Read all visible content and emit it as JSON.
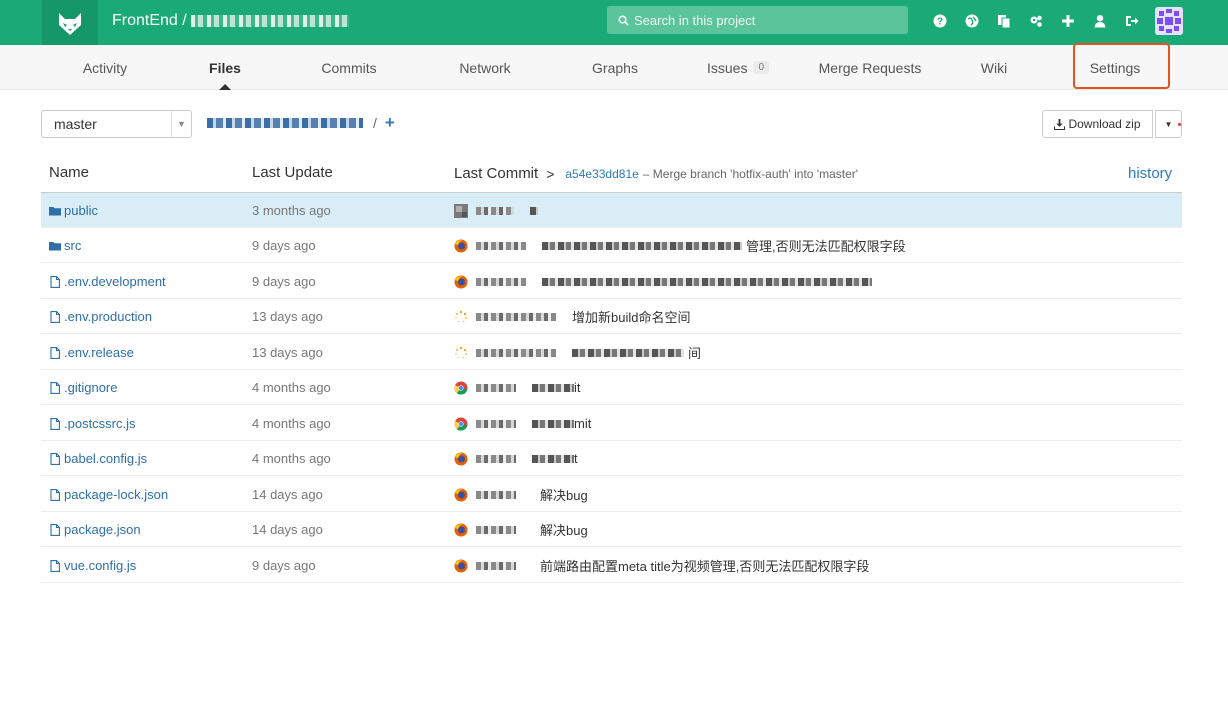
{
  "header": {
    "project_group": "FrontEnd /",
    "search_placeholder": "Search in this project",
    "icons": [
      "help-icon",
      "globe-icon",
      "copy-icon",
      "cogs-icon",
      "plus-icon",
      "user-icon",
      "sign-out-icon"
    ]
  },
  "nav": {
    "tabs": [
      {
        "label": "Activity"
      },
      {
        "label": "Files"
      },
      {
        "label": "Commits"
      },
      {
        "label": "Network"
      },
      {
        "label": "Graphs"
      },
      {
        "label": "Issues",
        "badge": "0"
      },
      {
        "label": "Merge Requests"
      },
      {
        "label": "Wiki"
      },
      {
        "label": "Settings"
      }
    ],
    "active_tab": "Files"
  },
  "toolbar": {
    "branch": "master",
    "breadcrumb_separator": "/",
    "breadcrumb_add": "+",
    "download_label": "Download zip"
  },
  "table": {
    "columns": {
      "name": "Name",
      "last_update": "Last Update",
      "last_commit": "Last Commit",
      "arrow": ">"
    },
    "last_commit_sha": "a54e33dd81e",
    "last_commit_message": "– Merge branch 'hotfix-auth' into 'master'",
    "history_label": "history",
    "rows": [
      {
        "name": "public",
        "type": "folder",
        "updated": "3 months ago",
        "commit_message": ""
      },
      {
        "name": "src",
        "type": "folder",
        "updated": "9 days ago",
        "commit_message": "管理,否则无法匹配权限字段"
      },
      {
        "name": ".env.development",
        "type": "file",
        "updated": "9 days ago",
        "commit_message": ""
      },
      {
        "name": ".env.production",
        "type": "file",
        "updated": "13 days ago",
        "commit_message": "增加新build命名空间"
      },
      {
        "name": ".env.release",
        "type": "file",
        "updated": "13 days ago",
        "commit_message": "间"
      },
      {
        "name": ".gitignore",
        "type": "file",
        "updated": "4 months ago",
        "commit_message": "it"
      },
      {
        "name": ".postcssrc.js",
        "type": "file",
        "updated": "4 months ago",
        "commit_message": "mit"
      },
      {
        "name": "babel.config.js",
        "type": "file",
        "updated": "4 months ago",
        "commit_message": "t"
      },
      {
        "name": "package-lock.json",
        "type": "file",
        "updated": "14 days ago",
        "commit_message": "解决bug"
      },
      {
        "name": "package.json",
        "type": "file",
        "updated": "14 days ago",
        "commit_message": "解决bug"
      },
      {
        "name": "vue.config.js",
        "type": "file",
        "updated": "9 days ago",
        "commit_message": "前端路由配置meta title为视频管理,否则无法匹配权限字段"
      }
    ]
  },
  "colors": {
    "header_bg": "#1aaa76",
    "link": "#2d6fa8",
    "selected_row": "#d9edf7",
    "settings_highlight": "#e2531f"
  }
}
